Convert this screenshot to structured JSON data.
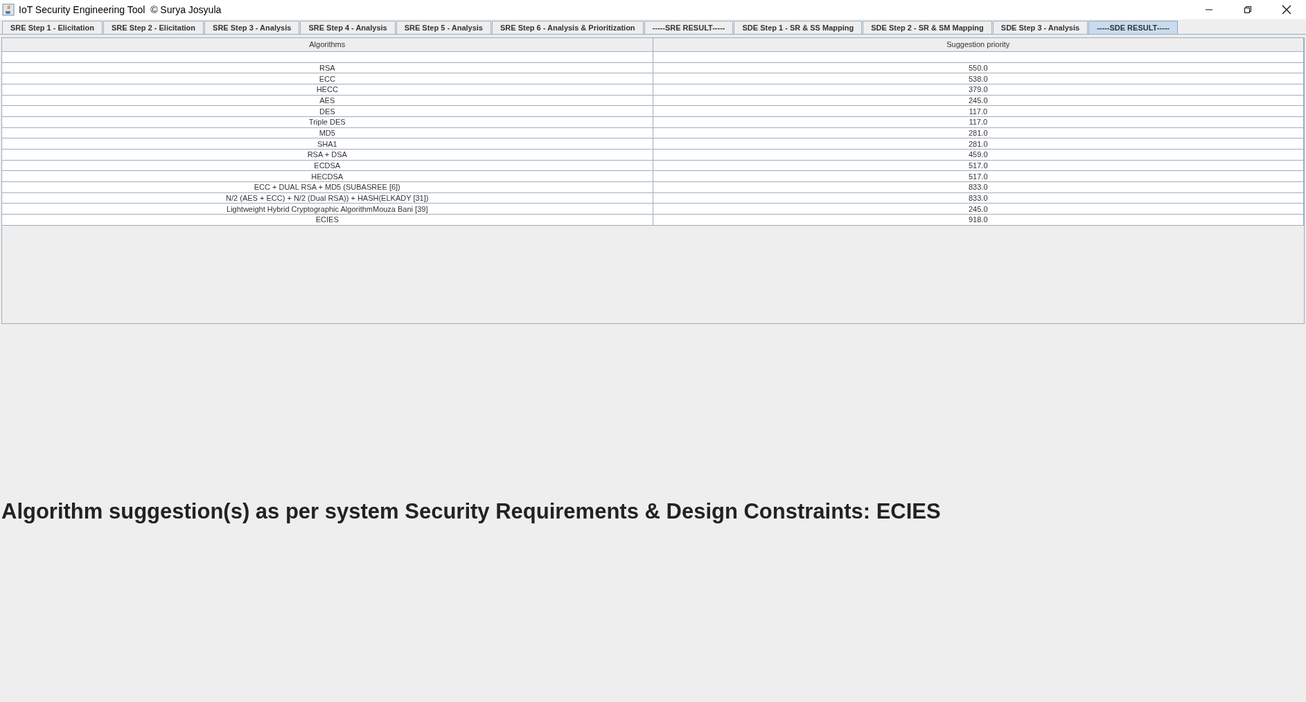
{
  "window": {
    "title": "IoT Security Engineering Tool  © Surya Josyula"
  },
  "tabs": [
    {
      "label": "SRE Step 1 - Elicitation",
      "selected": false
    },
    {
      "label": "SRE Step 2 - Elicitation",
      "selected": false
    },
    {
      "label": "SRE Step 3 - Analysis",
      "selected": false
    },
    {
      "label": "SRE Step 4 - Analysis",
      "selected": false
    },
    {
      "label": "SRE Step 5 - Analysis",
      "selected": false
    },
    {
      "label": "SRE Step 6 - Analysis & Prioritization",
      "selected": false
    },
    {
      "label": "-----SRE RESULT-----",
      "selected": false
    },
    {
      "label": "SDE Step 1 - SR & SS Mapping",
      "selected": false
    },
    {
      "label": "SDE Step 2 - SR & SM Mapping",
      "selected": false
    },
    {
      "label": "SDE Step 3 - Analysis",
      "selected": false
    },
    {
      "label": "-----SDE RESULT-----",
      "selected": true
    }
  ],
  "table": {
    "columns": [
      "Algorithms",
      "Suggestion priority"
    ],
    "rows": [
      [
        "RSA",
        "550.0"
      ],
      [
        "ECC",
        "538.0"
      ],
      [
        "HECC",
        "379.0"
      ],
      [
        "AES",
        "245.0"
      ],
      [
        "DES",
        "117.0"
      ],
      [
        "Triple DES",
        "117.0"
      ],
      [
        "MD5",
        "281.0"
      ],
      [
        "SHA1",
        "281.0"
      ],
      [
        "RSA + DSA",
        "459.0"
      ],
      [
        "ECDSA",
        "517.0"
      ],
      [
        "HECDSA",
        "517.0"
      ],
      [
        "ECC + DUAL RSA + MD5 (SUBASREE [6])",
        "833.0"
      ],
      [
        "N/2 (AES + ECC) + N/2 (Dual RSA)) + HASH(ELKADY [31])",
        "833.0"
      ],
      [
        "Lightweight Hybrid Cryptographic AlgorithmMouza Bani [39]",
        "245.0"
      ],
      [
        "ECIES",
        "918.0"
      ]
    ]
  },
  "result": "Algorithm suggestion(s) as per system Security Requirements & Design Constraints: ECIES"
}
